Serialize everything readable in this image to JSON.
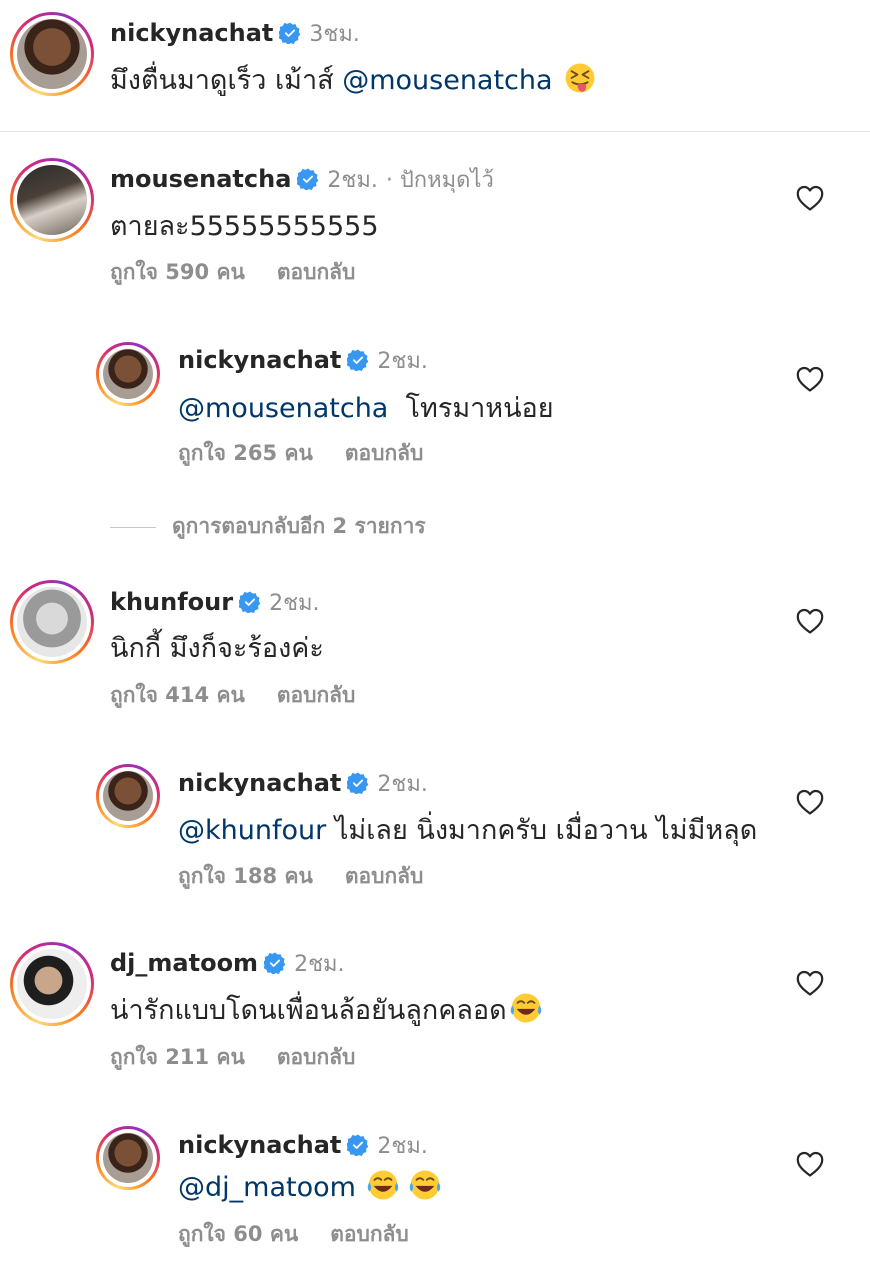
{
  "caption": {
    "username": "nickynachat",
    "time": "3ชม.",
    "text": "มึงตื่นมาดูเร็ว เม้าส์",
    "mention": "@mousenatcha"
  },
  "comments": [
    {
      "username": "mousenatcha",
      "time": "2ชม.",
      "pinned": "· ปักหมุดไว้",
      "text": "ตายละ55555555555",
      "likes": "ถูกใจ 590 คน",
      "reply": "ตอบกลับ"
    },
    {
      "username": "nickynachat",
      "time": "2ชม.",
      "mention": "@mousenatcha",
      "text": "โทรมาหน่อย",
      "likes": "ถูกใจ 265 คน",
      "reply": "ตอบกลับ"
    },
    {
      "username": "khunfour",
      "time": "2ชม.",
      "text": "นิกกี้ มึงก็จะร้องค่ะ",
      "likes": "ถูกใจ 414 คน",
      "reply": "ตอบกลับ"
    },
    {
      "username": "nickynachat",
      "time": "2ชม.",
      "mention": "@khunfour",
      "text": "ไม่เลย นิ่งมากครับ เมื่อวาน ไม่มีหลุด",
      "likes": "ถูกใจ 188 คน",
      "reply": "ตอบกลับ"
    },
    {
      "username": "dj_matoom",
      "time": "2ชม.",
      "text": "น่ารักแบบโดนเพื่อนล้อยันลูกคลอด",
      "likes": "ถูกใจ 211 คน",
      "reply": "ตอบกลับ"
    },
    {
      "username": "nickynachat",
      "time": "2ชม.",
      "mention": "@dj_matoom",
      "likes": "ถูกใจ 60 คน",
      "reply": "ตอบกลับ"
    }
  ],
  "view_more_replies": "ดูการตอบกลับอีก 2 รายการ",
  "icons": {
    "verified": "verified-badge-icon",
    "heart": "heart-outline-icon",
    "emoji_squint_tongue": "squinting-face-with-tongue",
    "emoji_laugh": "face-with-tears-of-joy"
  },
  "colors": {
    "mention": "#00376b",
    "verified": "#3897f0",
    "muted": "#8e8e8e"
  }
}
